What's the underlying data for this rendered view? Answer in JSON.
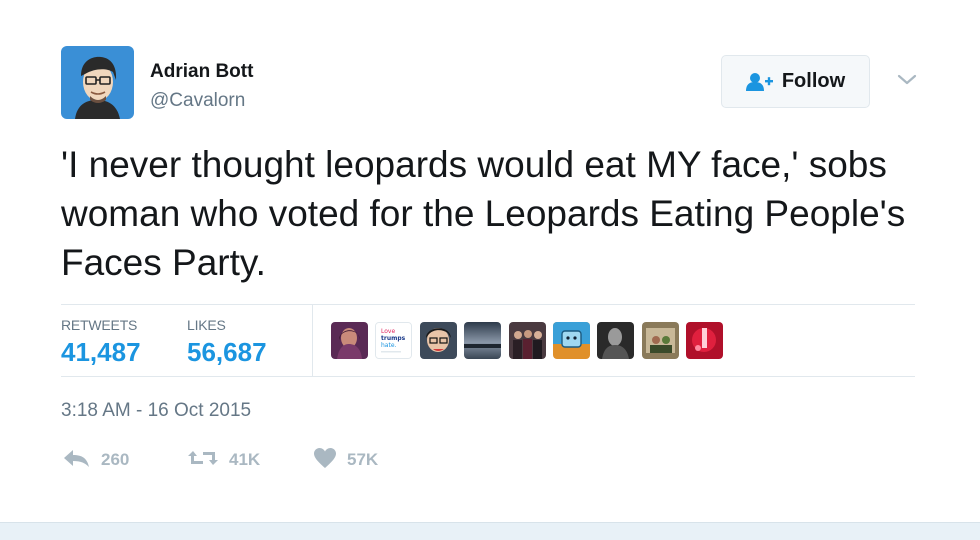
{
  "author": {
    "display_name": "Adrian Bott",
    "handle": "@Cavalorn"
  },
  "follow_button": {
    "label": "Follow"
  },
  "tweet": {
    "text": "'I never thought leopards would eat MY face,' sobs woman who voted for the Leopards Eating People's Faces Party.",
    "timestamp": "3:18 AM - 16 Oct 2015"
  },
  "stats": {
    "retweets_label": "RETWEETS",
    "retweets_value": "41,487",
    "likes_label": "LIKES",
    "likes_value": "56,687"
  },
  "liker_avatars": [
    {
      "name": "liker-avatar-1"
    },
    {
      "name": "liker-avatar-2",
      "text_lines": [
        "Love",
        "trumps",
        "hate."
      ]
    },
    {
      "name": "liker-avatar-3"
    },
    {
      "name": "liker-avatar-4"
    },
    {
      "name": "liker-avatar-5"
    },
    {
      "name": "liker-avatar-6"
    },
    {
      "name": "liker-avatar-7"
    },
    {
      "name": "liker-avatar-8"
    },
    {
      "name": "liker-avatar-9"
    }
  ],
  "actions": {
    "reply_count": "260",
    "retweet_count": "41K",
    "like_count": "57K"
  },
  "icons": {
    "follow": "add-user-icon",
    "caret": "chevron-down-icon",
    "reply": "reply-icon",
    "retweet": "retweet-icon",
    "like": "heart-icon"
  },
  "colors": {
    "accent": "#1b95e0",
    "muted": "#657786",
    "action_gray": "#aab8c2",
    "text": "#14171a"
  }
}
